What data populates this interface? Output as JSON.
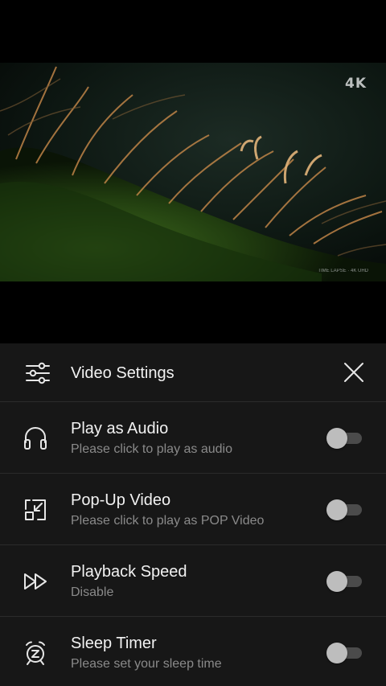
{
  "video": {
    "badge": "4K",
    "credit": "TIME LAPSE · 4K UHD"
  },
  "settings": {
    "title": "Video Settings",
    "header_icon": "sliders-icon",
    "close_icon": "close-icon",
    "items": [
      {
        "title": "Play as Audio",
        "subtitle": "Please click to play as audio",
        "icon": "headphones-icon",
        "enabled": false
      },
      {
        "title": "Pop-Up Video",
        "subtitle": "Please click to play as POP Video",
        "icon": "popup-icon",
        "enabled": false
      },
      {
        "title": "Playback Speed",
        "subtitle": "Disable",
        "icon": "fast-forward-icon",
        "enabled": false
      },
      {
        "title": "Sleep Timer",
        "subtitle": "Please set your sleep time",
        "icon": "alarm-clock-icon",
        "enabled": false
      }
    ]
  },
  "colors": {
    "sheet_background": "#171717",
    "divider": "#2b2b2b",
    "title_text": "#f2f2f2",
    "subtitle_text": "#8a8a8a",
    "toggle_track_off": "#4b4b4b",
    "toggle_thumb_off": "#bdbdbd"
  }
}
